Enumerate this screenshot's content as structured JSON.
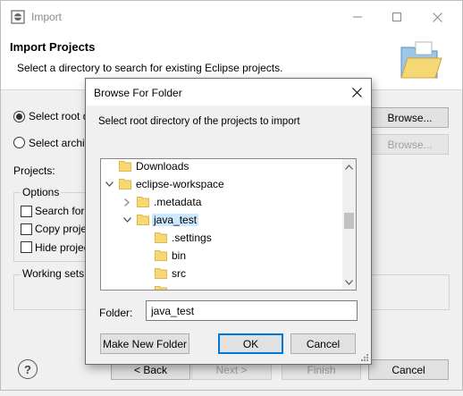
{
  "import_window": {
    "title": "Import",
    "header_title": "Import Projects",
    "header_desc": "Select a directory to search for existing Eclipse projects.",
    "select_root_label": "Select root d",
    "select_archive_label": "Select archiv",
    "browse_root_label": "Browse...",
    "browse_archive_label": "Browse...",
    "projects_label": "Projects:",
    "options_title": "Options",
    "options": [
      {
        "label": "Search for",
        "checked": false
      },
      {
        "label": "Copy proje",
        "checked": false
      },
      {
        "label": "Hide projec",
        "checked": false
      }
    ],
    "working_sets_title": "Working sets",
    "footer": {
      "back_label": "< Back",
      "next_label": "Next >",
      "finish_label": "Finish",
      "cancel_label": "Cancel"
    }
  },
  "browse_dialog": {
    "title": "Browse For Folder",
    "instruction": "Select root directory of the projects to import",
    "tree": [
      {
        "label": "Downloads",
        "twisty": "none",
        "selected": false
      },
      {
        "label": "eclipse-workspace",
        "twisty": "expanded",
        "selected": false
      },
      {
        "label": ".metadata",
        "twisty": "collapsed",
        "selected": false
      },
      {
        "label": "java_test",
        "twisty": "expanded",
        "selected": true
      },
      {
        "label": ".settings",
        "twisty": "none",
        "selected": false
      },
      {
        "label": "bin",
        "twisty": "none",
        "selected": false
      },
      {
        "label": "src",
        "twisty": "none",
        "selected": false
      },
      {
        "label": "",
        "twisty": "none",
        "selected": false
      }
    ],
    "folder_label": "Folder:",
    "folder_value": "java_test",
    "make_new_folder_label": "Make New Folder",
    "ok_label": "OK",
    "cancel_label": "Cancel"
  },
  "colors": {
    "folder": "#f8d775",
    "folder_dark": "#e0b64a",
    "selection": "#cce8ff",
    "accent": "#0078d7"
  }
}
